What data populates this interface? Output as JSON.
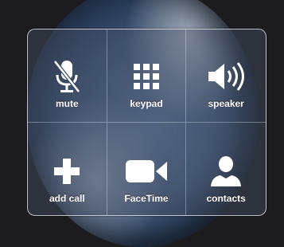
{
  "call_options": {
    "buttons": [
      {
        "label": "mute",
        "icon": "microphone-muted-icon"
      },
      {
        "label": "keypad",
        "icon": "keypad-grid-icon"
      },
      {
        "label": "speaker",
        "icon": "speaker-icon"
      },
      {
        "label": "add call",
        "icon": "plus-icon"
      },
      {
        "label": "FaceTime",
        "icon": "video-camera-icon"
      },
      {
        "label": "contacts",
        "icon": "person-icon"
      }
    ]
  },
  "colors": {
    "icon": "#ffffff",
    "panel_border": "#e6ebf5",
    "background": "#1c1c1e"
  }
}
